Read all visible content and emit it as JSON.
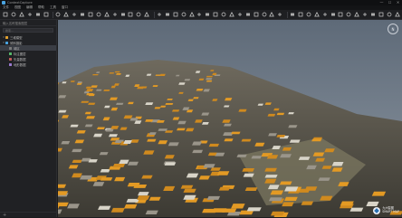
{
  "window": {
    "title": "ContextCapture",
    "controls": [
      "—",
      "☐",
      "✕"
    ]
  },
  "menu": [
    "文件",
    "视图",
    "编辑",
    "帮助",
    "工具",
    "窗口"
  ],
  "toolbar": {
    "icons": [
      "new-icon",
      "open-icon",
      "save-icon",
      "undo-icon",
      "redo-icon",
      "home-icon",
      "layers-icon",
      "cube-icon",
      "grid-icon",
      "mesh-icon",
      "measure-icon",
      "point-icon",
      "line-icon",
      "polygon-icon",
      "area-icon",
      "volume-icon",
      "camera-icon",
      "light-icon",
      "sun-icon",
      "globe-icon",
      "map-icon",
      "pin-icon",
      "ruler-icon",
      "angle-icon",
      "profile-icon",
      "crop-icon",
      "clip-icon",
      "export-icon",
      "import-icon",
      "settings-icon",
      "info-icon",
      "help-icon",
      "fullscreen-icon",
      "play-icon",
      "record-icon",
      "screenshot-icon",
      "share-icon",
      "search-icon",
      "filter-icon",
      "lock-icon",
      "visible-icon",
      "color-icon",
      "texture-icon",
      "shadow-icon",
      "fly-icon",
      "walk-icon",
      "orbit-icon",
      "pan-icon"
    ]
  },
  "sidebar": {
    "header": "输入名称搜索图层",
    "search_placeholder": "搜索...",
    "tree": [
      {
        "label": "三维模型",
        "level": 0,
        "expanded": true,
        "color": "#e0a030",
        "selected": false
      },
      {
        "label": "倾斜摄影",
        "level": 0,
        "expanded": true,
        "color": "#4aa3df",
        "selected": false
      },
      {
        "label": "城区",
        "level": 1,
        "expanded": false,
        "color": "#7a7a7a",
        "selected": true
      },
      {
        "label": "标注图层",
        "level": 1,
        "expanded": false,
        "color": "#57b86a",
        "selected": false
      },
      {
        "label": "矢量数据",
        "level": 1,
        "expanded": false,
        "color": "#c05a5a",
        "selected": false
      },
      {
        "label": "地形数据",
        "level": 1,
        "expanded": false,
        "color": "#9a7ad0",
        "selected": false
      }
    ]
  },
  "viewport": {
    "compass_label": "N",
    "watermark_line1": "九州智图",
    "watermark_line2": "SMART MAP"
  }
}
